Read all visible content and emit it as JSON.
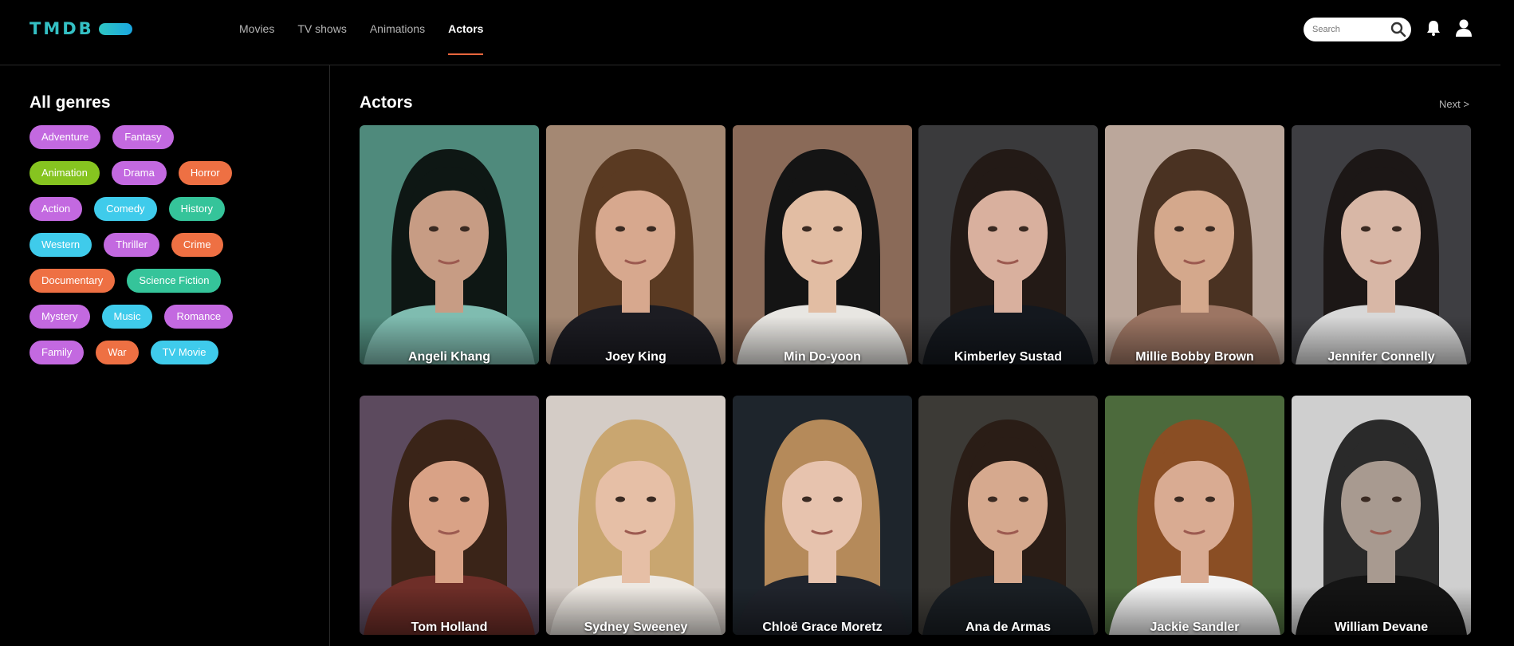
{
  "header": {
    "logo_text": "TMDB",
    "nav": [
      {
        "label": "Movies",
        "active": false
      },
      {
        "label": "TV shows",
        "active": false
      },
      {
        "label": "Animations",
        "active": false
      },
      {
        "label": "Actors",
        "active": true
      }
    ],
    "search": {
      "placeholder": "Search",
      "value": ""
    },
    "accent_color": "#e8663d"
  },
  "sidebar": {
    "title": "All genres",
    "genre_rows": [
      [
        {
          "label": "Adventure",
          "color": "purple"
        },
        {
          "label": "Fantasy",
          "color": "purple"
        }
      ],
      [
        {
          "label": "Animation",
          "color": "green"
        },
        {
          "label": "Drama",
          "color": "purple"
        },
        {
          "label": "Horror",
          "color": "orange"
        }
      ],
      [
        {
          "label": "Action",
          "color": "purple"
        },
        {
          "label": "Comedy",
          "color": "cyan"
        },
        {
          "label": "History",
          "color": "teal"
        }
      ],
      [
        {
          "label": "Western",
          "color": "cyan"
        },
        {
          "label": "Thriller",
          "color": "purple"
        },
        {
          "label": "Crime",
          "color": "orange"
        }
      ],
      [
        {
          "label": "Documentary",
          "color": "orange"
        },
        {
          "label": "Science Fiction",
          "color": "teal"
        }
      ],
      [
        {
          "label": "Mystery",
          "color": "purple"
        },
        {
          "label": "Music",
          "color": "cyan"
        },
        {
          "label": "Romance",
          "color": "purple"
        }
      ],
      [
        {
          "label": "Family",
          "color": "purple"
        },
        {
          "label": "War",
          "color": "orange"
        },
        {
          "label": "TV Movie",
          "color": "cyan"
        }
      ]
    ]
  },
  "main": {
    "title": "Actors",
    "next_label": "Next >",
    "actors": [
      {
        "name": "Angeli Khang",
        "bg": "#4f8a7c",
        "hair": "#0e1714",
        "skin": "#c79c84",
        "cloth": "#7fbcb0"
      },
      {
        "name": "Joey King",
        "bg": "#a48873",
        "hair": "#5a3a22",
        "skin": "#d7a88e",
        "cloth": "#1c1c22"
      },
      {
        "name": "Min Do-yoon",
        "bg": "#8a6a58",
        "hair": "#141414",
        "skin": "#e2bda3",
        "cloth": "#e8e6e2"
      },
      {
        "name": "Kimberley Sustad",
        "bg": "#3a3a3c",
        "hair": "#231a16",
        "skin": "#d9b09e",
        "cloth": "#14181e"
      },
      {
        "name": "Millie Bobby Brown",
        "bg": "#bba79b",
        "hair": "#4a3222",
        "skin": "#d4a88c",
        "cloth": "#9c7563"
      },
      {
        "name": "Jennifer Connelly",
        "bg": "#3e3e42",
        "hair": "#1c1716",
        "skin": "#d8b7a6",
        "cloth": "#d8d8d8"
      },
      {
        "name": "Tom Holland",
        "bg": "#5c4a5e",
        "hair": "#3a2418",
        "skin": "#d9a286",
        "cloth": "#6e2e28"
      },
      {
        "name": "Sydney Sweeney",
        "bg": "#d4ccc6",
        "hair": "#c9a670",
        "skin": "#e6bfa6",
        "cloth": "#ede8e2"
      },
      {
        "name": "Chloë Grace Moretz",
        "bg": "#1e252c",
        "hair": "#b58a5a",
        "skin": "#e7c3ae",
        "cloth": "#20242c"
      },
      {
        "name": "Ana de Armas",
        "bg": "#3c3a36",
        "hair": "#2a1d16",
        "skin": "#d6a98e",
        "cloth": "#1a1f24"
      },
      {
        "name": "Jackie Sandler",
        "bg": "#4c6a3c",
        "hair": "#8a4e24",
        "skin": "#d9ab92",
        "cloth": "#f2f2f2"
      },
      {
        "name": "William Devane",
        "bg": "#cfcfcf",
        "hair": "#2a2a2a",
        "skin": "#a89a90",
        "cloth": "#141414"
      }
    ]
  },
  "chip_colors": {
    "purple": "#c369e0",
    "orange": "#ee7043",
    "green": "#86c420",
    "cyan": "#3fcbeb",
    "teal": "#35c49a"
  }
}
